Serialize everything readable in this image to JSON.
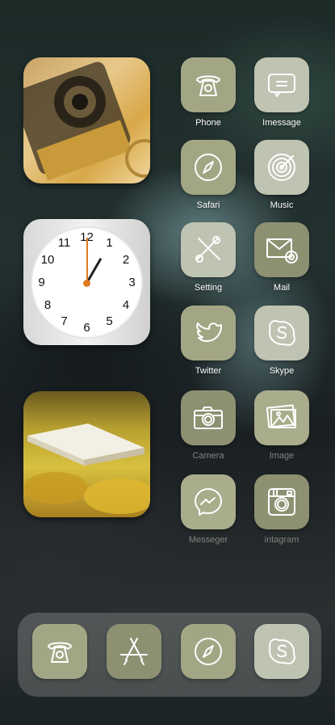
{
  "apps": [
    {
      "label": "Phone",
      "icon": "phone-icon"
    },
    {
      "label": "Imessage",
      "icon": "message-icon"
    },
    {
      "label": "Safari",
      "icon": "compass-icon"
    },
    {
      "label": "Music",
      "icon": "vinyl-icon"
    },
    {
      "label": "Setting",
      "icon": "tools-icon"
    },
    {
      "label": "Mail",
      "icon": "mail-icon"
    },
    {
      "label": "Twitter",
      "icon": "twitter-icon"
    },
    {
      "label": "Skype",
      "icon": "skype-icon"
    },
    {
      "label": "Camera",
      "icon": "camera-icon"
    },
    {
      "label": "Image",
      "icon": "image-icon"
    },
    {
      "label": "Messeger",
      "icon": "messenger-icon"
    },
    {
      "label": "intagram",
      "icon": "instagram-icon"
    }
  ],
  "clock": {
    "numbers": [
      "12",
      "1",
      "2",
      "3",
      "4",
      "5",
      "6",
      "7",
      "8",
      "9",
      "10",
      "11"
    ],
    "hour_hand_color": "#222222",
    "minute_hand_color": "#e07a1f"
  },
  "dock": [
    "phone-icon",
    "app-store-icon",
    "compass-icon",
    "skype-icon"
  ],
  "colors": {
    "icon_olive": "#a3a684",
    "icon_light": "#bfc3b2",
    "icon_dark": "#8d9172"
  }
}
